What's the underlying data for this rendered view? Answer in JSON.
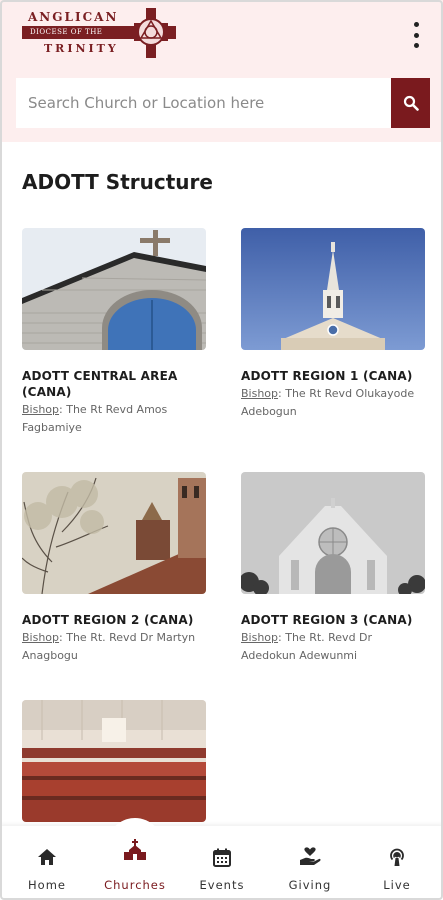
{
  "header": {
    "logo_top": "ANGLICAN",
    "logo_band": "DIOCESE OF THE",
    "logo_bottom": "TRINITY",
    "brand_color": "#7a1a1e",
    "menu_icon": "kebab-menu-icon"
  },
  "search": {
    "placeholder": "Search Church or Location here",
    "value": "",
    "button_icon": "search-icon"
  },
  "section": {
    "title": "ADOTT Structure"
  },
  "cards": [
    {
      "name": "ADOTT CENTRAL AREA (CANA)",
      "bishop_label": "Bishop",
      "bishop_name": ": The Rt Revd Amos Fagbamiye"
    },
    {
      "name": "ADOTT REGION 1 (CANA)",
      "bishop_label": "Bishop",
      "bishop_name": ": The Rt Revd Olukayode Adebogun"
    },
    {
      "name": "ADOTT REGION 2 (CANA)",
      "bishop_label": "Bishop",
      "bishop_name": ": The Rt. Revd Dr Martyn Anagbogu"
    },
    {
      "name": "ADOTT REGION 3 (CANA)",
      "bishop_label": "Bishop",
      "bishop_name": ": The Rt. Revd Dr Adedokun Adewunmi"
    },
    {
      "name": "",
      "bishop_label": "",
      "bishop_name": ""
    }
  ],
  "tabbar": {
    "items": [
      {
        "label": "Home",
        "icon": "home-icon"
      },
      {
        "label": "Churches",
        "icon": "church-icon"
      },
      {
        "label": "Events",
        "icon": "calendar-icon"
      },
      {
        "label": "Giving",
        "icon": "giving-hand-icon"
      },
      {
        "label": "Live",
        "icon": "broadcast-icon"
      }
    ],
    "active": "Churches",
    "active_color": "#7a1a1e"
  }
}
